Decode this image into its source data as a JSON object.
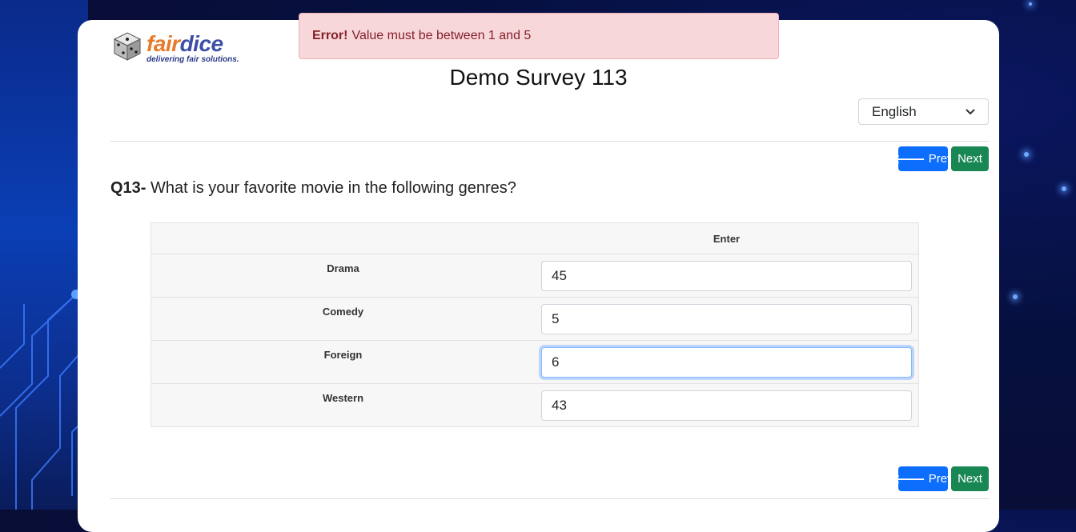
{
  "alert": {
    "strong": "Error!",
    "message": "Value must be between 1 and 5"
  },
  "logo": {
    "part1": "fair",
    "part2": "dice",
    "tagline": "delivering fair solutions."
  },
  "survey": {
    "title": "Demo Survey 113"
  },
  "language": {
    "selected": "English"
  },
  "nav": {
    "prev_label": "Prev",
    "next_label": "Next"
  },
  "question": {
    "number": "Q13-",
    "text": "What is your favorite movie in the following genres?"
  },
  "grid": {
    "column_header": "Enter",
    "rows": [
      {
        "label": "Drama",
        "value": "45"
      },
      {
        "label": "Comedy",
        "value": "5"
      },
      {
        "label": "Foreign",
        "value": "6"
      },
      {
        "label": "Western",
        "value": "43"
      }
    ]
  },
  "colors": {
    "prev": "#0d6efd",
    "next": "#198754",
    "alert_bg": "#f8d7da",
    "alert_text": "#842029"
  }
}
